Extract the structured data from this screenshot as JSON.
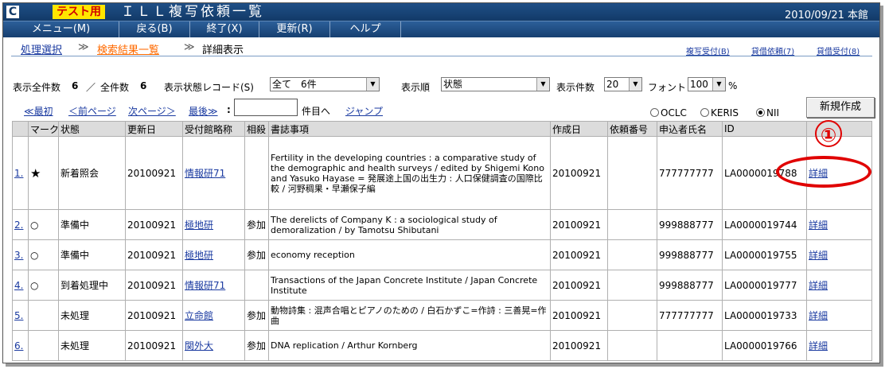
{
  "titlebar": {
    "logo": "C",
    "badge": "テスト用",
    "title": "ＩＬＬ複写依頼一覧",
    "date": "2010/09/21 本館"
  },
  "menu": [
    "メニュー(M)",
    "戻る(B)",
    "終了(X)",
    "更新(R)",
    "ヘルプ"
  ],
  "breadcrumb": {
    "item1": "処理選択",
    "sep": "≫",
    "item2": "検索結果一覧",
    "item3": "詳細表示"
  },
  "toplinks": [
    "複写受付(B)",
    "貸借依頼(7)",
    "貸借受付(8)"
  ],
  "controls": {
    "total_label": "表示全件数",
    "total_count": "6",
    "slash": "／",
    "all_label": "全件数",
    "all_count": "6",
    "status_label": "表示状態レコード(S)",
    "status_value": "全て　6件",
    "order_label": "表示順",
    "order_value": "状態",
    "count_label": "表示件数",
    "count_value": "20",
    "font_label": "フォント",
    "font_value": "100",
    "percent": "%"
  },
  "pager": {
    "first": "≪最初",
    "prev": "＜前ページ",
    "next": "次ページ＞",
    "last": "最後≫",
    "colon": ":",
    "goto_label": "件目へ",
    "jump": "ジャンプ"
  },
  "radios": [
    {
      "label": "OCLC",
      "selected": false
    },
    {
      "label": "KERIS",
      "selected": false
    },
    {
      "label": "NII",
      "selected": true
    }
  ],
  "new_button": "新規作成",
  "table": {
    "headers": [
      "",
      "マーク",
      "状態",
      "更新日",
      "受付館略称",
      "相殺",
      "書誌事項",
      "作成日",
      "依頼番号",
      "申込者氏名",
      "ID",
      ""
    ],
    "rows": [
      {
        "no": "1.",
        "mark": "★",
        "status": "新着照会",
        "updated": "20100921",
        "library": "情報研71",
        "offset": "",
        "title": "Fertility in the developing countries : a comparative study of the demographic and health surveys / edited by Shigemi Kono and Yasuko Hayase = 発展途上国の出生力 : 人口保健調査の国際比較 / 河野稠果・早瀬保子編",
        "created": "20100921",
        "request_no": "",
        "applicant": "777777777",
        "id": "LA0000019788",
        "detail": "詳細"
      },
      {
        "no": "2.",
        "mark": "○",
        "status": "準備中",
        "updated": "20100921",
        "library": "極地研",
        "offset": "参加",
        "title": "The derelicts of Company K : a sociological study of demoralization / by Tamotsu Shibutani",
        "created": "20100921",
        "request_no": "",
        "applicant": "999888777",
        "id": "LA0000019744",
        "detail": "詳細"
      },
      {
        "no": "3.",
        "mark": "○",
        "status": "準備中",
        "updated": "20100921",
        "library": "極地研",
        "offset": "参加",
        "title": "economy reception",
        "created": "20100921",
        "request_no": "",
        "applicant": "999888777",
        "id": "LA0000019755",
        "detail": "詳細"
      },
      {
        "no": "4.",
        "mark": "○",
        "status": "到着処理中",
        "updated": "20100921",
        "library": "情報研71",
        "offset": "",
        "title": "Transactions of the Japan Concrete Institute / Japan Concrete Institute",
        "created": "20100921",
        "request_no": "",
        "applicant": "999888777",
        "id": "LA0000019777",
        "detail": "詳細"
      },
      {
        "no": "5.",
        "mark": "",
        "status": "未処理",
        "updated": "20100921",
        "library": "立命館",
        "offset": "参加",
        "title": "動物詩集 : 混声合唱とピアノのための / 白石かずこ=作詩 : 三善晃=作曲",
        "created": "20100921",
        "request_no": "",
        "applicant": "777777777",
        "id": "LA0000019733",
        "detail": "詳細"
      },
      {
        "no": "6.",
        "mark": "",
        "status": "未処理",
        "updated": "20100921",
        "library": "関外大",
        "offset": "参加",
        "title": "DNA replication / Arthur Kornberg",
        "created": "20100921",
        "request_no": "",
        "applicant": "",
        "id": "LA0000019766",
        "detail": "詳細"
      }
    ]
  },
  "annotation": {
    "number": "①",
    "color": "#e00000"
  },
  "colors": {
    "title_bar": "#123a68",
    "link": "#1a3aa0",
    "current_crumb": "#ff6a00",
    "badge_bg": "#ffe600"
  }
}
